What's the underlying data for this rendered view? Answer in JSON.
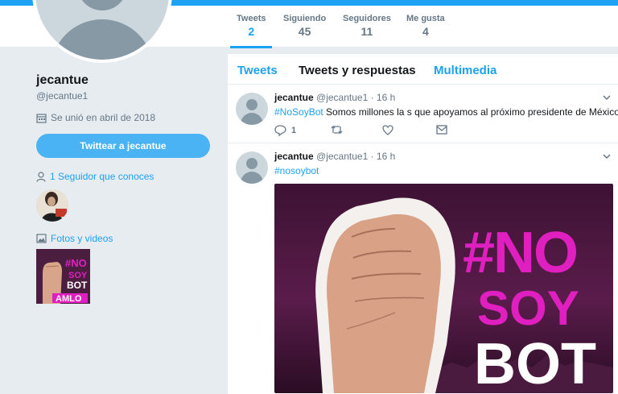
{
  "stats": [
    {
      "label": "Tweets",
      "value": "2"
    },
    {
      "label": "Siguiendo",
      "value": "45"
    },
    {
      "label": "Seguidores",
      "value": "11"
    },
    {
      "label": "Me gusta",
      "value": "4"
    }
  ],
  "profile": {
    "name": "jecantue",
    "handle": "@jecantue1",
    "joined": "Se unió en abril de 2018",
    "tweet_to_label": "Twittear a jecantue",
    "followers_you_know": "1 Seguidor que conoces",
    "photos_label": "Fotos y videos"
  },
  "tabs": [
    "Tweets",
    "Tweets y respuestas",
    "Multimedia"
  ],
  "tweets": [
    {
      "name": "jecantue",
      "meta": "@jecantue1 · 16 h",
      "hashtag": "#NoSoyBot",
      "text": " Somos millones la s que apoyamos al próximo presidente de México",
      "replies": "1"
    },
    {
      "name": "jecantue",
      "meta": "@jecantue1 · 16 h",
      "hashtag": "#nosoybot",
      "text": ""
    }
  ],
  "media": {
    "thumb_lines": [
      "#NO",
      "SOY",
      "BOT",
      "AMLO"
    ],
    "image_lines": [
      "#NO",
      "SOY",
      "BOT"
    ]
  },
  "colors": {
    "accent": "#1da1f2",
    "magenta": "#e01fc0",
    "background": "#e6ecf0"
  }
}
